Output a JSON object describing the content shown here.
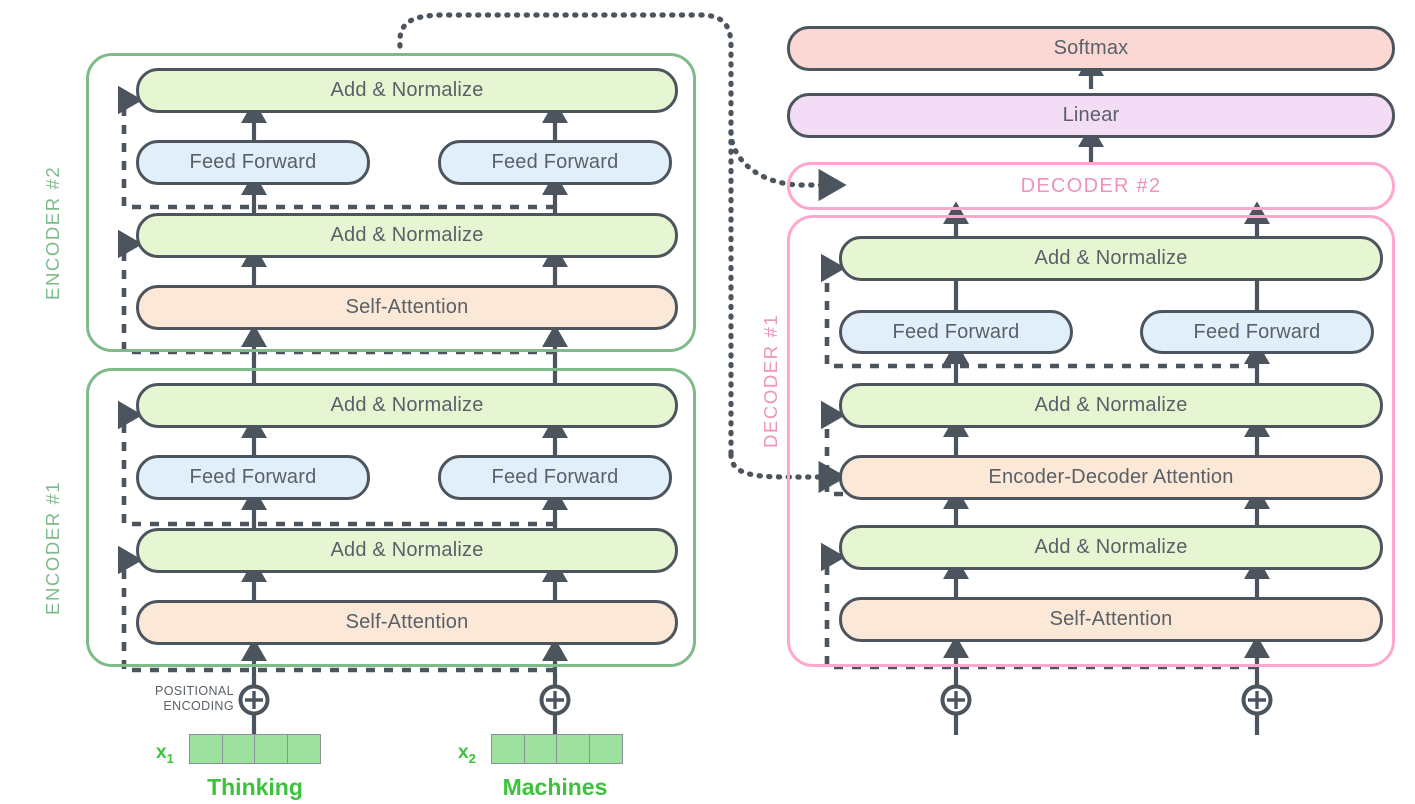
{
  "title": "Transformer encoder-decoder architecture diagram",
  "labels": {
    "encoder2": "ENCODER #2",
    "encoder1": "ENCODER #1",
    "decoder2": "DECODER #2",
    "decoder1": "DECODER #1",
    "positional_encoding": "POSITIONAL\nENCODING",
    "positional_encoding_line1": "POSITIONAL",
    "positional_encoding_line2": "ENCODING",
    "plus_symbol": "⊕"
  },
  "encoder_stack": {
    "encoder2": {
      "name": "ENCODER #2",
      "layers": [
        {
          "id": "add-norm-top",
          "label": "Add & Normalize",
          "color": "#e7f6d2",
          "span": "full"
        },
        {
          "id": "feed-forward-left",
          "label": "Feed Forward",
          "color": "#e1effb",
          "span": "half"
        },
        {
          "id": "feed-forward-right",
          "label": "Feed Forward",
          "color": "#e1effb",
          "span": "half"
        },
        {
          "id": "add-norm-bottom",
          "label": "Add & Normalize",
          "color": "#e7f6d2",
          "span": "full"
        },
        {
          "id": "self-attention",
          "label": "Self-Attention",
          "color": "#fbe8d6",
          "span": "full"
        }
      ]
    },
    "encoder1": {
      "name": "ENCODER #1",
      "layers": [
        {
          "id": "add-norm-top",
          "label": "Add & Normalize",
          "color": "#e7f6d2",
          "span": "full"
        },
        {
          "id": "feed-forward-left",
          "label": "Feed Forward",
          "color": "#e1effb",
          "span": "half"
        },
        {
          "id": "feed-forward-right",
          "label": "Feed Forward",
          "color": "#e1effb",
          "span": "half"
        },
        {
          "id": "add-norm-bottom",
          "label": "Add & Normalize",
          "color": "#e7f6d2",
          "span": "full"
        },
        {
          "id": "self-attention",
          "label": "Self-Attention",
          "color": "#fbe8d6",
          "span": "full"
        }
      ]
    }
  },
  "decoder_stack": {
    "output_head": [
      {
        "id": "softmax",
        "label": "Softmax",
        "color": "#fbd8d4"
      },
      {
        "id": "linear",
        "label": "Linear",
        "color": "#f3dcf6"
      }
    ],
    "decoder2": {
      "name": "DECODER #2"
    },
    "decoder1": {
      "name": "DECODER #1",
      "layers": [
        {
          "id": "add-norm-top",
          "label": "Add & Normalize",
          "color": "#e7f6d2",
          "span": "full"
        },
        {
          "id": "feed-forward-left",
          "label": "Feed Forward",
          "color": "#e1effb",
          "span": "half"
        },
        {
          "id": "feed-forward-right",
          "label": "Feed Forward",
          "color": "#e1effb",
          "span": "half"
        },
        {
          "id": "add-norm-mid",
          "label": "Add & Normalize",
          "color": "#e7f6d2",
          "span": "full"
        },
        {
          "id": "encoder-decoder-attention",
          "label": "Encoder-Decoder Attention",
          "color": "#fbe8d6",
          "span": "full"
        },
        {
          "id": "add-norm-bottom",
          "label": "Add & Normalize",
          "color": "#e7f6d2",
          "span": "full"
        },
        {
          "id": "self-attention",
          "label": "Self-Attention",
          "color": "#fbe8d6",
          "span": "full"
        }
      ]
    }
  },
  "inputs": [
    {
      "id": "x1",
      "token_label": "x",
      "token_index": "1",
      "word": "Thinking",
      "cells": 4
    },
    {
      "id": "x2",
      "token_label": "x",
      "token_index": "2",
      "word": "Machines",
      "cells": 4
    }
  ],
  "colors": {
    "add_normalize": "#e7f6d2",
    "feed_forward": "#e1effb",
    "attention": "#fbe8d6",
    "softmax": "#fbd8d4",
    "linear": "#f3dcf6",
    "encoder_border": "#7fbb8a",
    "decoder_border": "#ffa7ce",
    "block_border": "#4c545e",
    "text": "#5a6068",
    "embedding_cell": "#9ee09e",
    "word_text": "#3cc23c"
  }
}
